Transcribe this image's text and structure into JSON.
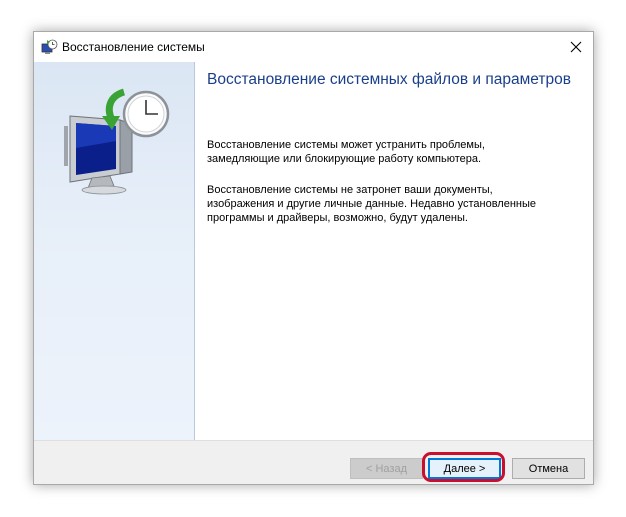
{
  "window": {
    "title": "Восстановление системы",
    "close_glyph": "✕"
  },
  "icons": {
    "title_icon": "system-restore-icon",
    "hero_icon": "monitor-clock-restore-icon",
    "close_icon": "close-icon"
  },
  "content": {
    "heading": "Восстановление системных файлов и параметров",
    "para1_lines": [
      "Восстановление системы может устранить проблемы,",
      "замедляющие или блокирующие работу компьютера."
    ],
    "para2_lines": [
      "Восстановление системы не затронет ваши документы,",
      "изображения и другие личные данные. Недавно установленные",
      "программы и драйверы, возможно, будут удалены."
    ]
  },
  "buttons": {
    "back_label": "< Назад",
    "next_label": "Далее >",
    "cancel_label": "Отмена"
  },
  "colors": {
    "heading": "#1a3f8a",
    "highlight": "#c8102e",
    "focus_border": "#0078d7"
  }
}
